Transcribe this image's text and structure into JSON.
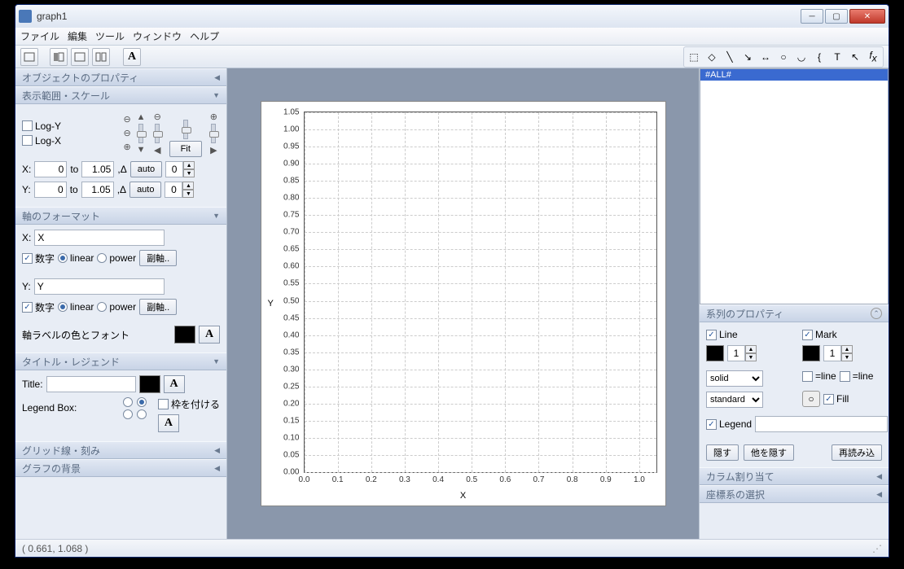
{
  "window": {
    "title": "graph1"
  },
  "menu": {
    "file": "ファイル",
    "edit": "編集",
    "tool": "ツール",
    "window": "ウィンドウ",
    "help": "ヘルプ"
  },
  "left": {
    "objprops": "オブジェクトのプロパティ",
    "viewscale": "表示範囲・スケール",
    "logy": "Log-Y",
    "logx": "Log-X",
    "fit": "Fit",
    "to": "to",
    "auto": "auto",
    "delta": ",Δ",
    "x_from": "0",
    "x_to": "1.05",
    "y_from": "0",
    "y_to": "1.05",
    "spin0a": "0",
    "spin0b": "0",
    "axisfmt": "軸のフォーマット",
    "xlabel": "X:",
    "ylabel": "Y:",
    "xval": "X",
    "yval": "Y",
    "numeral": "数字",
    "linear": "linear",
    "power": "power",
    "subaxis": "副軸..",
    "axislabelcolor": "軸ラベルの色とフォント",
    "titlelegend": "タイトル・レジェンド",
    "titlelbl": "Title:",
    "titleval": "",
    "legendbox": "Legend Box:",
    "frame": "枠を付ける",
    "gridticks": "グリッド線・刻み",
    "bg": "グラフの背景"
  },
  "right": {
    "listitem": "#ALL#",
    "seriesprops": "系列のプロパティ",
    "line": "Line",
    "mark": "Mark",
    "width1": "1",
    "width2": "1",
    "solid": "solid",
    "standard": "standard",
    "eqline": "=line",
    "fill": "Fill",
    "legend": "Legend",
    "legendval": "",
    "hide": "隠す",
    "hideothers": "他を隠す",
    "reload": "再読み込",
    "colassign": "カラム割り当て",
    "coord": "座標系の選択"
  },
  "status": {
    "coords": "( 0.661,  1.068 )"
  },
  "chart_data": {
    "type": "scatter",
    "title": "",
    "xlabel": "X",
    "ylabel": "Y",
    "xlim": [
      0,
      1.05
    ],
    "ylim": [
      0,
      1.05
    ],
    "xticks": [
      0.0,
      0.1,
      0.2,
      0.3,
      0.4,
      0.5,
      0.6,
      0.7,
      0.8,
      0.9,
      1.0
    ],
    "yticks": [
      0.0,
      0.05,
      0.1,
      0.15,
      0.2,
      0.25,
      0.3,
      0.35,
      0.4,
      0.45,
      0.5,
      0.55,
      0.6,
      0.65,
      0.7,
      0.75,
      0.8,
      0.85,
      0.9,
      0.95,
      1.0,
      1.05
    ],
    "series": []
  }
}
